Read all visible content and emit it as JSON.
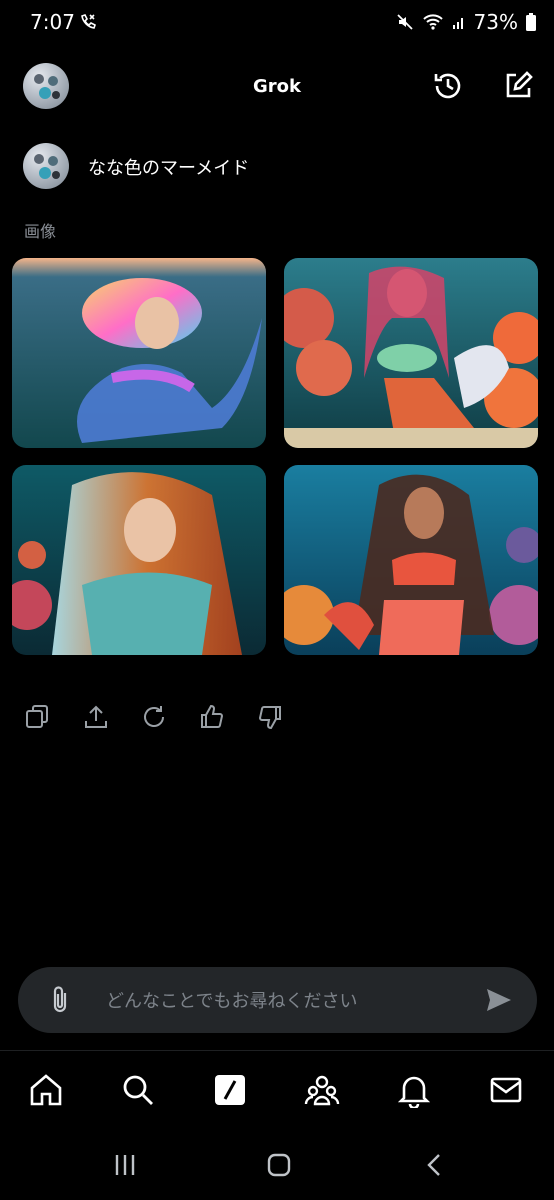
{
  "status_bar": {
    "time": "7:07",
    "battery": "73%",
    "icons": [
      "call-forward-icon",
      "mute-icon",
      "wifi-icon",
      "signal-icon",
      "battery-icon"
    ]
  },
  "header": {
    "title": "Grok",
    "avatar_icon": "profile-avatar",
    "history_icon": "history-icon",
    "new_chat_icon": "compose-icon"
  },
  "message": {
    "text": "なな色のマーメイド"
  },
  "images_section": {
    "label": "画像",
    "images": [
      {
        "name": "mermaid-image-1"
      },
      {
        "name": "mermaid-image-2"
      },
      {
        "name": "mermaid-image-3"
      },
      {
        "name": "mermaid-image-4"
      }
    ]
  },
  "actions": [
    "copy-icon",
    "share-icon",
    "regenerate-icon",
    "thumbs-up-icon",
    "thumbs-down-icon"
  ],
  "composer": {
    "placeholder": "どんなことでもお尋ねください",
    "attach_icon": "paperclip-icon",
    "send_icon": "send-icon"
  },
  "bottom_nav": [
    "home-icon",
    "search-icon",
    "grok-icon",
    "communities-icon",
    "notifications-icon",
    "messages-icon"
  ],
  "system_nav": [
    "recents-icon",
    "home-circle-icon",
    "back-icon"
  ]
}
